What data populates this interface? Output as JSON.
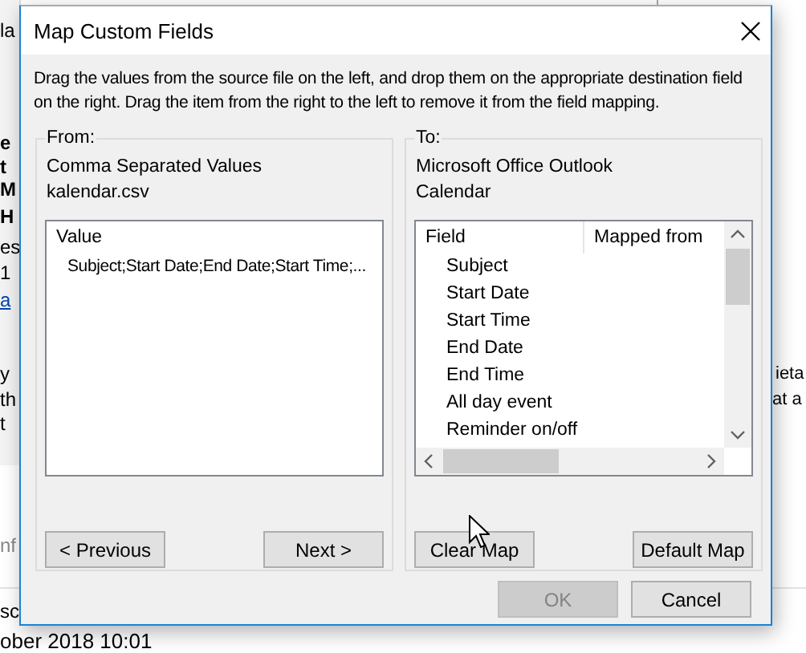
{
  "background": {
    "texts": [
      {
        "text": "la",
        "kind": "plain"
      },
      {
        "text": "e",
        "kind": "bold"
      },
      {
        "text": "t",
        "kind": "bold"
      },
      {
        "text": "M",
        "kind": "bold"
      },
      {
        "text": "H",
        "kind": "bold"
      },
      {
        "text": "es",
        "kind": "plain"
      },
      {
        "text": "1",
        "kind": "plain"
      },
      {
        "text": "a",
        "kind": "link"
      },
      {
        "text": "y",
        "kind": "plain"
      },
      {
        "text": "th",
        "kind": "plain"
      },
      {
        "text": "t",
        "kind": "plain"
      },
      {
        "text": "ieta",
        "kind": "plain"
      },
      {
        "text": "at a",
        "kind": "plain"
      },
      {
        "text": "nf",
        "kind": "muted"
      },
      {
        "text": "sc",
        "kind": "plain"
      },
      {
        "text": "ober 2018 10:01",
        "kind": "plain"
      }
    ]
  },
  "window": {
    "title": "Map Custom Fields"
  },
  "instructions": "Drag the values from the source file on the left, and drop them on the appropriate destination field on the right.  Drag the item from the right to the left to remove it from the field mapping.",
  "from": {
    "label": "From:",
    "lines": [
      "Comma Separated Values",
      "kalendar.csv"
    ],
    "list": {
      "columns": [
        "Value"
      ],
      "items": [
        "Subject;Start Date;End Date;Start Time;..."
      ]
    },
    "buttons": [
      {
        "label": "< Previous",
        "disabled": false
      },
      {
        "label": "Next >",
        "disabled": false
      }
    ]
  },
  "to": {
    "label": "To:",
    "lines": [
      "Microsoft Office Outlook",
      "Calendar"
    ],
    "list": {
      "columns": [
        "Field",
        "Mapped from"
      ],
      "items": [
        "Subject",
        "Start Date",
        "Start Time",
        "End Date",
        "End Time",
        "All day event",
        "Reminder on/off"
      ]
    },
    "buttons": [
      {
        "label": "Clear Map",
        "disabled": false
      },
      {
        "label": "Default Map",
        "disabled": false
      }
    ]
  },
  "buttons": [
    {
      "label": "OK",
      "disabled": true
    },
    {
      "label": "Cancel",
      "disabled": false
    }
  ]
}
